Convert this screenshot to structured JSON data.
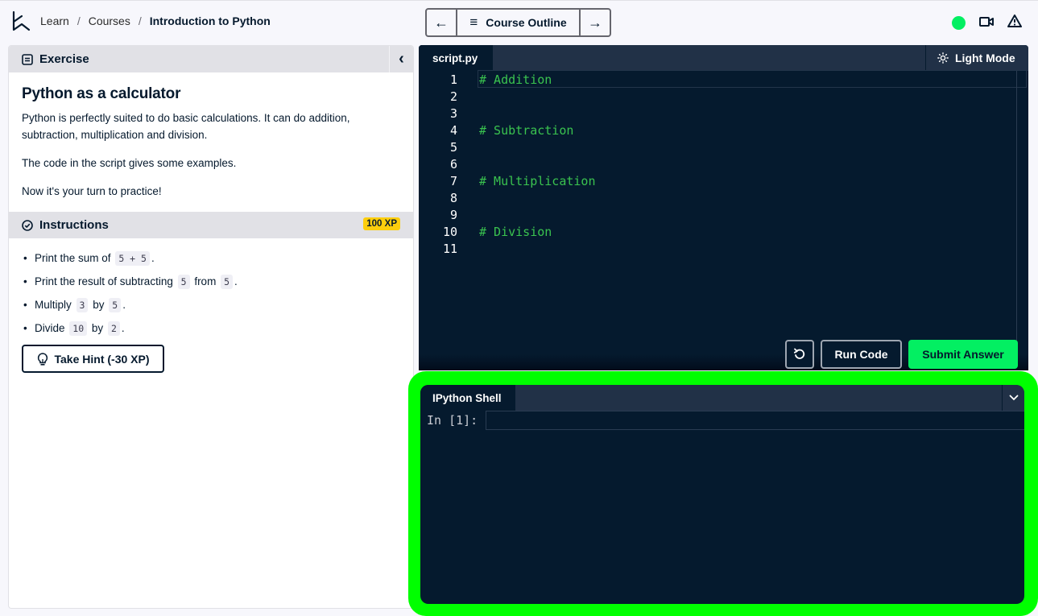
{
  "header": {
    "logo": "datacamp-logo-icon",
    "breadcrumb": [
      "Learn",
      "Courses",
      "Introduction to Python"
    ],
    "breadcrumb_separator": "/",
    "course_nav": {
      "prev_icon": "←",
      "next_icon": "→",
      "outline_icon": "≡",
      "outline_label": "Course Outline"
    },
    "status_color": "#03ef62"
  },
  "exercise": {
    "header_label": "Exercise",
    "collapse_icon": "‹",
    "title": "Python as a calculator",
    "paragraphs": [
      "Python is perfectly suited to do basic calculations. It can do addition, subtraction, multiplication and division.",
      "The code in the script gives some examples.",
      "Now it's your turn to practice!"
    ]
  },
  "instructions": {
    "header_label": "Instructions",
    "xp_badge": "100 XP",
    "items": [
      {
        "before": "Print the sum of",
        "code1": "5 + 5",
        "middle": "",
        "code2": "",
        "after": "."
      },
      {
        "before": "Print the result of subtracting",
        "code1": "5",
        "middle": "from",
        "code2": "5",
        "after": "."
      },
      {
        "before": "Multiply",
        "code1": "3",
        "middle": "by",
        "code2": "5",
        "after": "."
      },
      {
        "before": "Divide",
        "code1": "10",
        "middle": "by",
        "code2": "2",
        "after": "."
      }
    ],
    "hint_label": "Take Hint (-30 XP)"
  },
  "editor": {
    "tab_label": "script.py",
    "light_mode_label": "Light Mode",
    "lines": [
      {
        "no": "1",
        "code": "# Addition"
      },
      {
        "no": "2",
        "code": ""
      },
      {
        "no": "3",
        "code": ""
      },
      {
        "no": "4",
        "code": "# Subtraction"
      },
      {
        "no": "5",
        "code": ""
      },
      {
        "no": "6",
        "code": ""
      },
      {
        "no": "7",
        "code": "# Multiplication"
      },
      {
        "no": "8",
        "code": ""
      },
      {
        "no": "9",
        "code": ""
      },
      {
        "no": "10",
        "code": "# Division"
      },
      {
        "no": "11",
        "code": ""
      }
    ],
    "run_label": "Run Code",
    "submit_label": "Submit Answer",
    "accent_color": "#03ef62"
  },
  "shell": {
    "tab_label": "IPython Shell",
    "prompt": "In [1]:",
    "input_value": "",
    "highlight_color": "#00ff00"
  }
}
